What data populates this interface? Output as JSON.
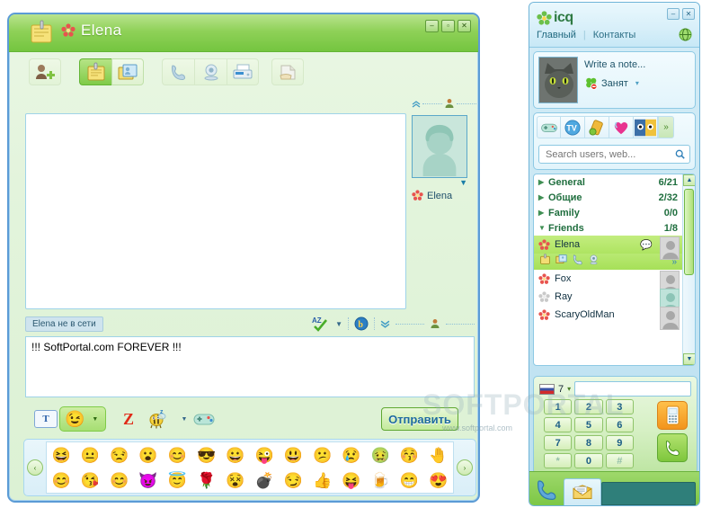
{
  "chat_window": {
    "title": "Elena",
    "title_icons": [
      "note-icon",
      "flower-icon"
    ],
    "window_controls": {
      "minimize": "–",
      "maximize": "▫",
      "close": "✕"
    },
    "toolbar": [
      {
        "name": "add-contact",
        "glyph": "👤",
        "active": false
      },
      {
        "name": "send-note",
        "glyph": "🗒",
        "active": true
      },
      {
        "name": "contact-card",
        "glyph": "🪪",
        "active": false
      },
      {
        "name": "phone-call",
        "glyph": "📞",
        "active": false
      },
      {
        "name": "webcam",
        "glyph": "📷",
        "active": false
      },
      {
        "name": "sms-fax",
        "glyph": "📠",
        "active": false
      },
      {
        "name": "file-history",
        "glyph": "📄",
        "active": false
      }
    ],
    "avatar": {
      "name": "Elena",
      "status_icon": "flower-icon"
    },
    "status_text": "Elena не в сети",
    "status_tools": [
      "spellcheck-az-icon",
      "dropdown-caret",
      "bing-b-icon",
      "chevron-down-icon",
      "person-icon"
    ],
    "input_value": "!!! SoftPortal.com FOREVER !!!",
    "bottom_toolbar": {
      "font_label": "T",
      "smiley": "smiley-icon",
      "xtraz_label": "Z",
      "bee": "bee-icon",
      "games": "gamepad-icon",
      "send_label": "Отправить"
    },
    "emoticons": {
      "nav_left": "‹",
      "nav_right": "›",
      "row1": [
        "😆",
        "😐",
        "😒",
        "😮",
        "😊",
        "😎",
        "😀",
        "😜",
        "😃",
        "😕",
        "😢",
        "🤢",
        "😚",
        "🤚"
      ],
      "row2": [
        "😊",
        "😘",
        "😊",
        "😈",
        "😇",
        "🌹",
        "😵",
        "💣",
        "😏",
        "👍",
        "😝",
        "🍺",
        "😁",
        "😍"
      ]
    }
  },
  "icq_window": {
    "brand": "icq",
    "window_controls": {
      "minimize": "–",
      "close": "✕"
    },
    "tabs": [
      {
        "label": "Главный",
        "active": true
      },
      {
        "label": "Контакты",
        "active": false
      }
    ],
    "tab_right_icon": "globe-icon",
    "profile": {
      "avatar": "cat-photo",
      "note_placeholder": "Write a note...",
      "status_icon": "clover-busy-icon",
      "status_label": "Занят",
      "status_caret": "▾"
    },
    "icon_strip": [
      {
        "name": "games-icon",
        "glyph": "🎮"
      },
      {
        "name": "tv-icon",
        "glyph": "📺"
      },
      {
        "name": "sms-icon",
        "glyph": "📱"
      },
      {
        "name": "hearts-icon",
        "glyph": "💕"
      },
      {
        "name": "avatars-icon",
        "glyph": "👀"
      }
    ],
    "icon_strip_more": "»",
    "search": {
      "placeholder": "Search users, web...",
      "value": "",
      "icon": "search-icon"
    },
    "groups": [
      {
        "label": "General",
        "count": "6/21",
        "expanded": false
      },
      {
        "label": "Общие",
        "count": "2/32",
        "expanded": false
      },
      {
        "label": "Family",
        "count": "0/0",
        "expanded": false
      },
      {
        "label": "Friends",
        "count": "1/8",
        "expanded": true
      }
    ],
    "contacts": [
      {
        "name": "Elena",
        "selected": true,
        "online": true,
        "badge": "chat-bubble-icon",
        "thumb": "grey"
      },
      {
        "name": "Fox",
        "selected": false,
        "online": true,
        "badge": "",
        "thumb": "grey"
      },
      {
        "name": "Ray",
        "selected": false,
        "online": false,
        "badge": "",
        "thumb": "teal"
      },
      {
        "name": "ScaryOldMan",
        "selected": false,
        "online": true,
        "badge": "",
        "thumb": "grey"
      }
    ],
    "contact_actions": [
      "send-note-icon",
      "contact-card-icon",
      "call-icon",
      "webcam-icon",
      "more-icon"
    ],
    "scrollbar": {
      "up": "▲",
      "down": "▼"
    },
    "dialer": {
      "flag": "russia-flag",
      "country_code": "7",
      "caret": "▾",
      "number_value": "",
      "keys": [
        "1",
        "2",
        "3",
        "4",
        "5",
        "6",
        "7",
        "8",
        "9",
        "*",
        "0",
        "#"
      ],
      "sms_button": "mobile-icon",
      "call_button": "call-icon"
    },
    "footer": {
      "phone_icon": "phone-handset-icon",
      "mail_tab_icon": "envelope-icon"
    }
  },
  "watermark": {
    "big": "SOFTPORTAL",
    "small": "www.softportal.com"
  }
}
